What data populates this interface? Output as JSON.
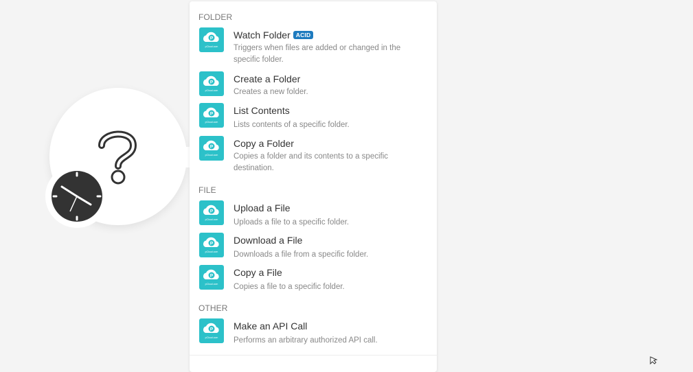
{
  "colors": {
    "app_icon_bg": "#2cc1c9",
    "badge_bg": "#1e7bbf",
    "clock_bg": "#333333"
  },
  "app": {
    "icon_name": "pcloud-icon",
    "icon_caption": "pCloud.com"
  },
  "module": {
    "icon_name": "question-mark-icon",
    "trigger_icon_name": "clock-icon"
  },
  "sections": [
    {
      "title": "FOLDER",
      "items": [
        {
          "title": "Watch Folder",
          "badge": "ACID",
          "description": "Triggers when files are added or changed in the specific folder."
        },
        {
          "title": "Create a Folder",
          "description": "Creates a new folder."
        },
        {
          "title": "List Contents",
          "description": "Lists contents of a specific folder."
        },
        {
          "title": "Copy a Folder",
          "description": "Copies a folder and its contents to a specific destination."
        }
      ]
    },
    {
      "title": "FILE",
      "items": [
        {
          "title": "Upload a File",
          "description": "Uploads a file to a specific folder."
        },
        {
          "title": "Download a File",
          "description": "Downloads a file from a specific folder."
        },
        {
          "title": "Copy a File",
          "description": "Copies a file to a specific folder."
        }
      ]
    },
    {
      "title": "OTHER",
      "items": [
        {
          "title": "Make an API Call",
          "description": "Performs an arbitrary authorized API call."
        }
      ]
    }
  ]
}
